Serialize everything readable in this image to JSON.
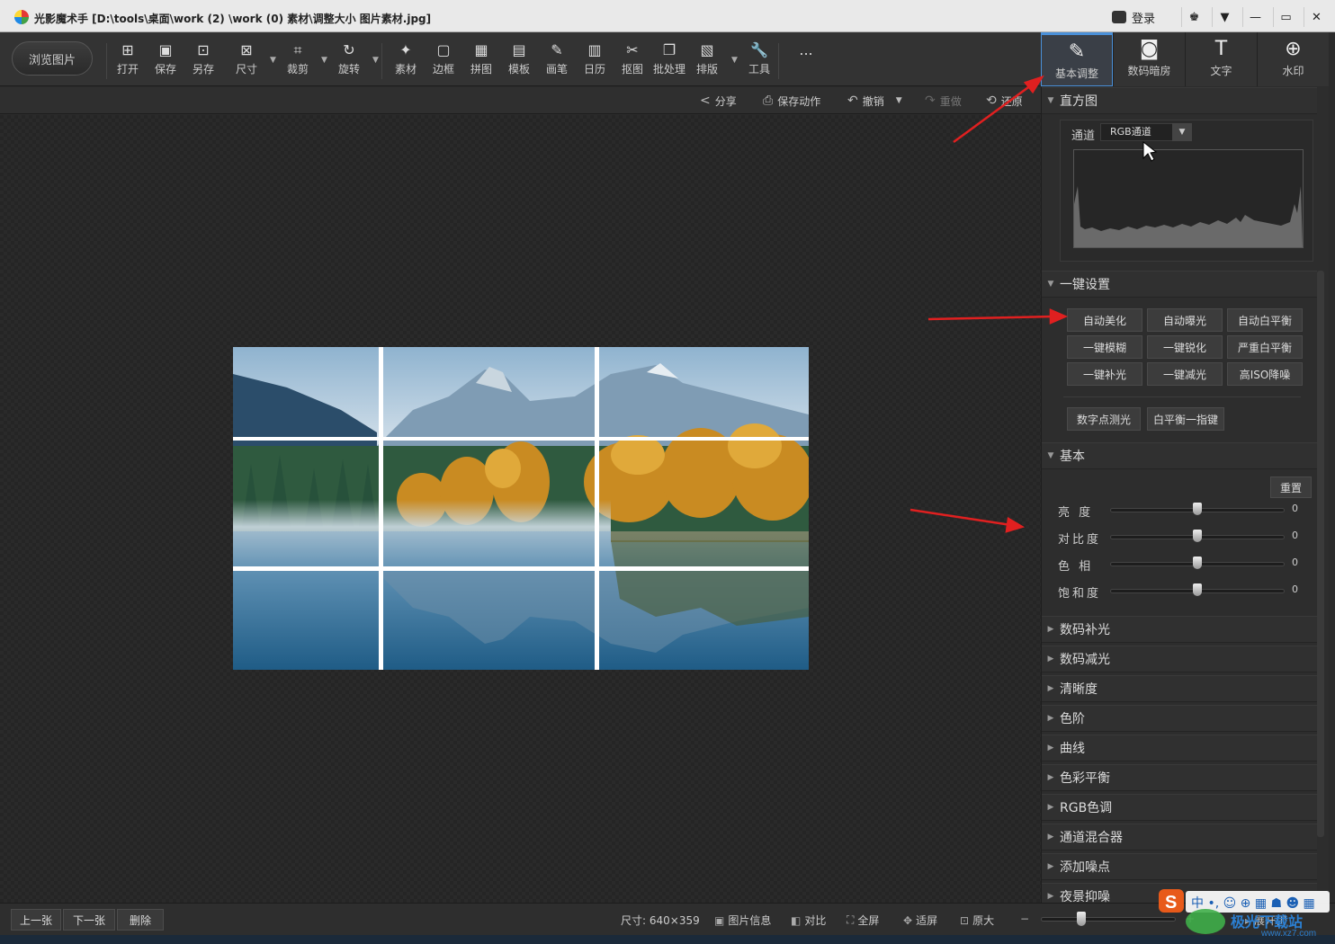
{
  "window": {
    "title": "光影魔术手 [D:\\tools\\桌面\\work (2) \\work (0) 素材\\调整大小 图片素材.jpg]",
    "login_label": "登录",
    "buttons": [
      "♚",
      "▼",
      "—",
      "▭",
      "✕"
    ]
  },
  "toolbar": {
    "browse_label": "浏览图片",
    "tools": [
      {
        "label": "打开",
        "icon": "open-icon",
        "glyph": "⊞"
      },
      {
        "label": "保存",
        "icon": "save-icon",
        "glyph": "▣"
      },
      {
        "label": "另存",
        "icon": "save-as-icon",
        "glyph": "⊡"
      },
      {
        "label": "尺寸",
        "icon": "resize-icon",
        "glyph": "⊠"
      },
      {
        "label": "裁剪",
        "icon": "crop-icon",
        "glyph": "⌗"
      },
      {
        "label": "旋转",
        "icon": "rotate-icon",
        "glyph": "↻"
      },
      {
        "label": "素材",
        "icon": "material-icon",
        "glyph": "✦"
      },
      {
        "label": "边框",
        "icon": "frame-icon",
        "glyph": "▢"
      },
      {
        "label": "拼图",
        "icon": "collage-icon",
        "glyph": "▦"
      },
      {
        "label": "模板",
        "icon": "template-icon",
        "glyph": "▤"
      },
      {
        "label": "画笔",
        "icon": "brush-icon",
        "glyph": "✎"
      },
      {
        "label": "日历",
        "icon": "calendar-icon",
        "glyph": "▥"
      },
      {
        "label": "抠图",
        "icon": "cutout-icon",
        "glyph": "✂"
      },
      {
        "label": "批处理",
        "icon": "batch-icon",
        "glyph": "❐"
      },
      {
        "label": "排版",
        "icon": "layout-icon",
        "glyph": "▧"
      },
      {
        "label": "工具",
        "icon": "wrench-icon",
        "glyph": "🔧"
      }
    ],
    "more": "..."
  },
  "secondary_bar": {
    "share": "分享",
    "save_action": "保存动作",
    "undo": "撤销",
    "redo": "重做",
    "restore": "还原"
  },
  "right_tabs": [
    {
      "label": "基本调整",
      "icon": "basic-adjust-icon",
      "glyph": "✎",
      "active": true
    },
    {
      "label": "数码暗房",
      "icon": "darkroom-icon",
      "glyph": "◙",
      "active": false
    },
    {
      "label": "文字",
      "icon": "text-icon",
      "glyph": "T",
      "active": false
    },
    {
      "label": "水印",
      "icon": "watermark-icon",
      "glyph": "⊕",
      "active": false
    }
  ],
  "histogram": {
    "title": "直方图",
    "channel_label": "通道",
    "channel_value": "RGB通道"
  },
  "oneclick": {
    "title": "一键设置",
    "buttons": [
      [
        "自动美化",
        "自动曝光",
        "自动白平衡"
      ],
      [
        "一键模糊",
        "一键锐化",
        "严重白平衡"
      ],
      [
        "一键补光",
        "一键减光",
        "高ISO降噪"
      ]
    ],
    "extra": [
      "数字点测光",
      "白平衡一指键"
    ]
  },
  "basic": {
    "title": "基本",
    "reset": "重置",
    "sliders": [
      {
        "label": "亮  度",
        "value": "0",
        "level": 0.5
      },
      {
        "label": "对比度",
        "value": "0",
        "level": 0.5
      },
      {
        "label": "色  相",
        "value": "0",
        "level": 0.5
      },
      {
        "label": "饱和度",
        "value": "0",
        "level": 0.5
      }
    ]
  },
  "collapsed_sections": [
    "数码补光",
    "数码减光",
    "清晰度",
    "色阶",
    "曲线",
    "色彩平衡",
    "RGB色调",
    "通道混合器",
    "添加噪点",
    "夜景抑噪"
  ],
  "bottom": {
    "prev": "上一张",
    "next": "下一张",
    "delete": "删除",
    "size": "尺寸: 640×359",
    "info": "图片信息",
    "compare": "对比",
    "fullscreen": "全屏",
    "fit": "适屏",
    "original": "原大",
    "expand": "展开(I)",
    "zoom_level": 0.3
  },
  "watermark": {
    "text": "极光下载站",
    "url": "www.xz7.com"
  },
  "colors": {
    "accent": "#4a90d9",
    "annotation": "#e02020"
  }
}
